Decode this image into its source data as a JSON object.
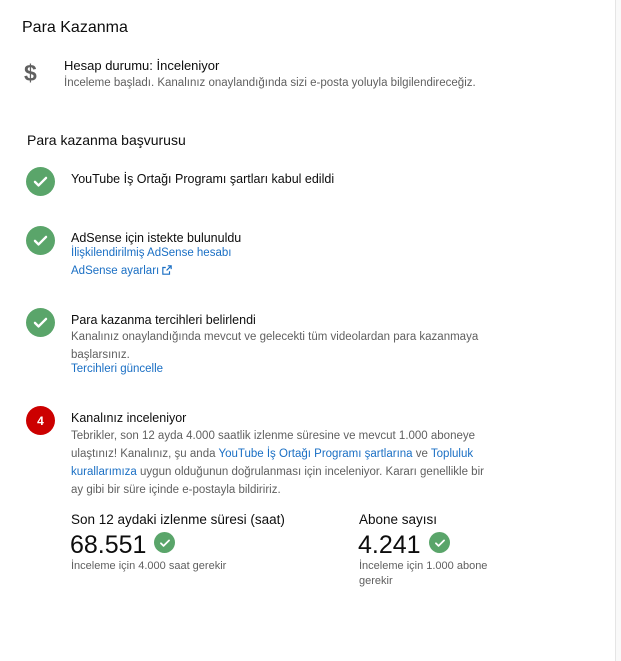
{
  "header": {
    "title": "Para Kazanma"
  },
  "account": {
    "icon": "dollar-icon",
    "status": "Hesap durumu: İnceleniyor",
    "description": "İnceleme başladı. Kanalınız onaylandığında sizi e-posta yoluyla bilgilendireceğiz."
  },
  "application": {
    "title": "Para kazanma başvurusu",
    "steps": [
      {
        "title": "YouTube İş Ortağı Programı şartları kabul edildi"
      },
      {
        "title": "AdSense için istekte bulunuldu",
        "link1": "İlişkilendirilmiş AdSense hesabı",
        "link2": "AdSense ayarları"
      },
      {
        "title": "Para kazanma tercihleri belirlendi",
        "description": "Kanalınız onaylandığında mevcut ve gelecekti tüm videolardan para kazanmaya başlarsınız.",
        "link": "Tercihleri güncelle"
      },
      {
        "badge": "4",
        "title": "Kanalınız inceleniyor",
        "desc_part1": "Tebrikler, son 12 ayda 4.000 saatlik izlenme süresine ve mevcut 1.000 aboneye ulaştınız! Kanalınız, şu anda ",
        "link_ypp": "YouTube İş Ortağı Programı şartlarına",
        "desc_part2": " ve ",
        "link_guidelines": "Topluluk kurallarımıza",
        "desc_part3": " uygun olduğunun doğrulanması için inceleniyor. Kararı genellikle bir ay gibi bir süre içinde e-postayla bildiririz."
      }
    ]
  },
  "stats": {
    "watch_time": {
      "label": "Son 12 aydaki izlenme süresi (saat)",
      "value": "68.551",
      "note": "İnceleme için 4.000 saat gerekir"
    },
    "subscribers": {
      "label": "Abone sayısı",
      "value": "4.241",
      "note": "İnceleme için 1.000 abone gerekir"
    }
  },
  "colors": {
    "check": "#5aa56a",
    "badge": "#cc0000",
    "link": "#1a6fc4",
    "secondary_text": "#606060"
  }
}
